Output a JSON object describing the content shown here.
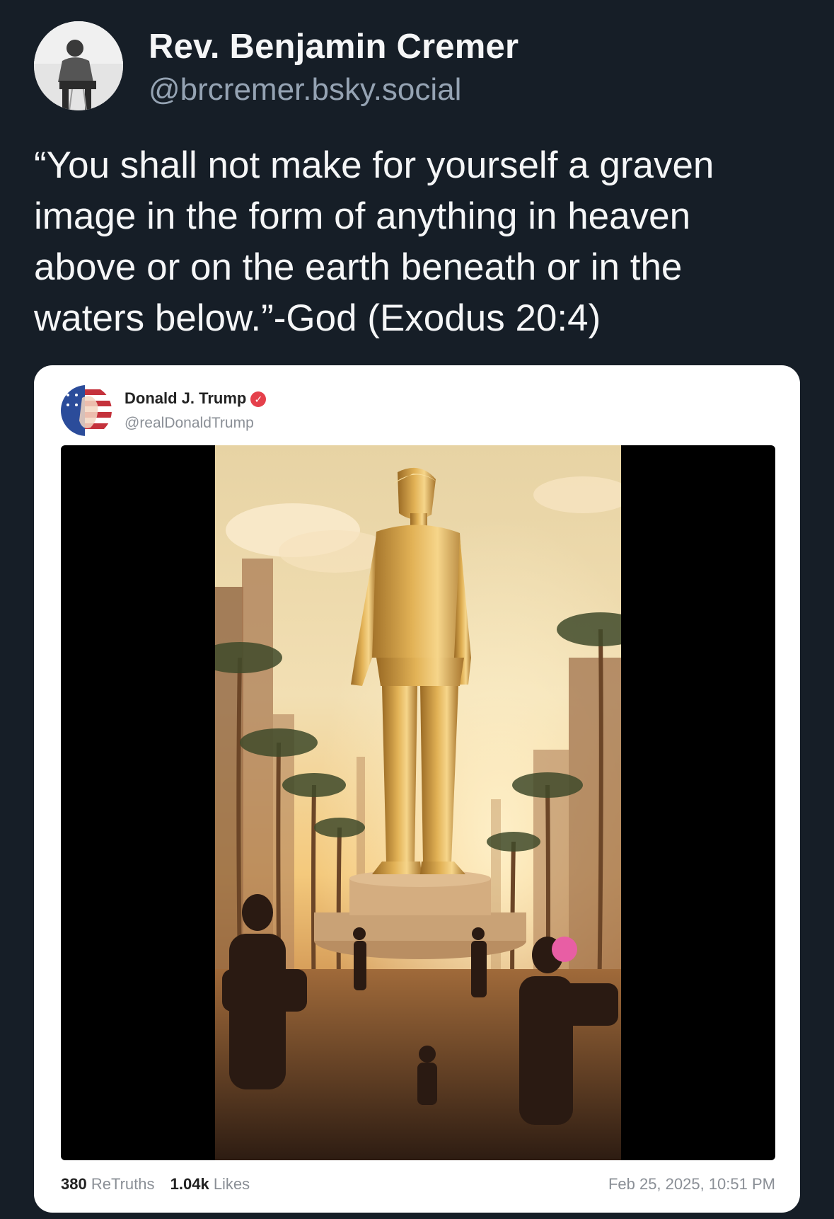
{
  "post": {
    "author_name": "Rev. Benjamin Cremer",
    "author_handle": "@brcremer.bsky.social",
    "text": "“You shall not make for yourself a graven\nimage in the form of anything in heaven\nabove or on the earth beneath or in the\nwaters below.”-God (Exodus 20:4)"
  },
  "embedded": {
    "author_name": "Donald J. Trump",
    "author_handle": "@realDonaldTrump",
    "verified_icon": "check-badge-icon",
    "retruths_count": "380",
    "retruths_label": "ReTruths",
    "likes_count": "1.04k",
    "likes_label": "Likes",
    "timestamp": "Feb 25, 2025, 10:51 PM"
  },
  "colors": {
    "background": "#161e27",
    "handle": "#95a3b3",
    "card": "#ffffff",
    "verified": "#e5404b"
  }
}
